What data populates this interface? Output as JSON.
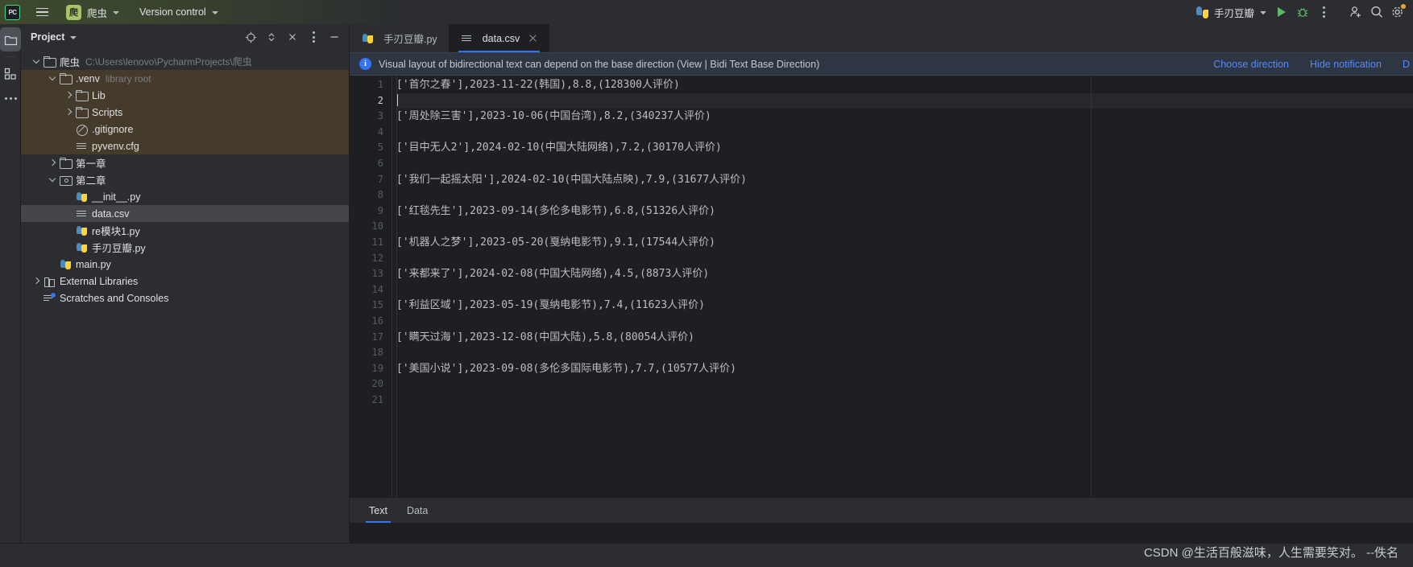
{
  "titlebar": {
    "logo_text": "PC",
    "menu_icon": "hamburger-icon",
    "project_badge": "爬",
    "project_name": "爬虫",
    "version_control": "Version control",
    "run_config": "手刃豆瓣",
    "run_icon": "run-icon",
    "debug_icon": "debug-icon",
    "more_icon": "more-actions-icon",
    "account_icon": "add-account-icon",
    "search_icon": "search-icon",
    "settings_icon": "gear-icon"
  },
  "rail": {
    "project_icon": "folder-icon",
    "structure_icon": "structure-icon",
    "more_icon": "more-tool-windows-icon",
    "debug_icon": "debug-bug-icon"
  },
  "project_panel": {
    "title": "Project",
    "tools": [
      "select-opened-file-icon",
      "expand-collapse-icon",
      "collapse-all-icon",
      "options-icon",
      "hide-icon"
    ],
    "tree": [
      {
        "label": "爬虫",
        "hint": "C:\\Users\\lenovo\\PycharmProjects\\爬虫",
        "icon": "folder-icon",
        "arrow": "down",
        "indent": 1,
        "state": "normal"
      },
      {
        "label": ".venv",
        "hint": "library root",
        "icon": "folder-icon",
        "arrow": "down",
        "indent": 2,
        "state": "venv"
      },
      {
        "label": "Lib",
        "hint": "",
        "icon": "folder-icon",
        "arrow": "right",
        "indent": 3,
        "state": "venv"
      },
      {
        "label": "Scripts",
        "hint": "",
        "icon": "folder-icon",
        "arrow": "right",
        "indent": 3,
        "state": "venv"
      },
      {
        "label": ".gitignore",
        "hint": "",
        "icon": "gitignore-icon",
        "arrow": "none",
        "indent": 3,
        "state": "venv"
      },
      {
        "label": "pyvenv.cfg",
        "hint": "",
        "icon": "config-file-icon",
        "arrow": "none",
        "indent": 3,
        "state": "venv"
      },
      {
        "label": "第一章",
        "hint": "",
        "icon": "folder-icon",
        "arrow": "right",
        "indent": 2,
        "state": "normal"
      },
      {
        "label": "第二章",
        "hint": "",
        "icon": "source-folder-icon",
        "arrow": "down",
        "indent": 2,
        "state": "normal"
      },
      {
        "label": "__init__.py",
        "hint": "",
        "icon": "python-file-icon",
        "arrow": "none",
        "indent": 3,
        "state": "normal"
      },
      {
        "label": "data.csv",
        "hint": "",
        "icon": "csv-file-icon",
        "arrow": "none",
        "indent": 3,
        "state": "selected"
      },
      {
        "label": "re模块1.py",
        "hint": "",
        "icon": "python-file-icon",
        "arrow": "none",
        "indent": 3,
        "state": "normal"
      },
      {
        "label": "手刃豆瓣.py",
        "hint": "",
        "icon": "python-file-icon",
        "arrow": "none",
        "indent": 3,
        "state": "normal"
      },
      {
        "label": "main.py",
        "hint": "",
        "icon": "python-file-icon",
        "arrow": "none",
        "indent": 2,
        "state": "normal"
      },
      {
        "label": "External Libraries",
        "hint": "",
        "icon": "external-libraries-icon",
        "arrow": "right",
        "indent": 1,
        "state": "normal"
      },
      {
        "label": "Scratches and Consoles",
        "hint": "",
        "icon": "scratches-icon",
        "arrow": "none",
        "indent": 1,
        "state": "normal"
      }
    ]
  },
  "editor": {
    "tabs": [
      {
        "label": "手刃豆瓣.py",
        "icon": "python-file-icon",
        "active": false,
        "closable": false
      },
      {
        "label": "data.csv",
        "icon": "csv-file-icon",
        "active": true,
        "closable": true
      }
    ],
    "notification": {
      "icon": "info-icon",
      "message": "Visual layout of bidirectional text can depend on the base direction (View | Bidi Text Base Direction)",
      "actions": [
        "Choose direction",
        "Hide notification",
        "D"
      ]
    },
    "lines": [
      {
        "no": "1",
        "text": "['首尔之春'],2023-11-22(韩国),8.8,(128300人评价)"
      },
      {
        "no": "2",
        "text": "",
        "caret": true
      },
      {
        "no": "3",
        "text": "['周处除三害'],2023-10-06(中国台湾),8.2,(340237人评价)"
      },
      {
        "no": "4",
        "text": ""
      },
      {
        "no": "5",
        "text": "['目中无人2'],2024-02-10(中国大陆网络),7.2,(30170人评价)"
      },
      {
        "no": "6",
        "text": ""
      },
      {
        "no": "7",
        "text": "['我们一起摇太阳'],2024-02-10(中国大陆点映),7.9,(31677人评价)"
      },
      {
        "no": "8",
        "text": ""
      },
      {
        "no": "9",
        "text": "['红毯先生'],2023-09-14(多伦多电影节),6.8,(51326人评价)"
      },
      {
        "no": "10",
        "text": ""
      },
      {
        "no": "11",
        "text": "['机器人之梦'],2023-05-20(戛纳电影节),9.1,(17544人评价)"
      },
      {
        "no": "12",
        "text": ""
      },
      {
        "no": "13",
        "text": "['来都来了'],2024-02-08(中国大陆网络),4.5,(8873人评价)"
      },
      {
        "no": "14",
        "text": ""
      },
      {
        "no": "15",
        "text": "['利益区域'],2023-05-19(戛纳电影节),7.4,(11623人评价)"
      },
      {
        "no": "16",
        "text": ""
      },
      {
        "no": "17",
        "text": "['瞒天过海'],2023-12-08(中国大陆),5.8,(80054人评价)"
      },
      {
        "no": "18",
        "text": ""
      },
      {
        "no": "19",
        "text": "['美国小说'],2023-09-08(多伦多国际电影节),7.7,(10577人评价)"
      },
      {
        "no": "20",
        "text": ""
      },
      {
        "no": "21",
        "text": ""
      }
    ],
    "bottom_tabs": [
      {
        "label": "Text",
        "active": true
      },
      {
        "label": "Data",
        "active": false
      }
    ]
  },
  "watermark": "CSDN @生活百般滋味，人生需要笑对。 --佚名",
  "colors": {
    "accent": "#3574f0",
    "venv_highlight": "#453b2a",
    "link": "#548af7",
    "run_green": "#5fb865"
  }
}
